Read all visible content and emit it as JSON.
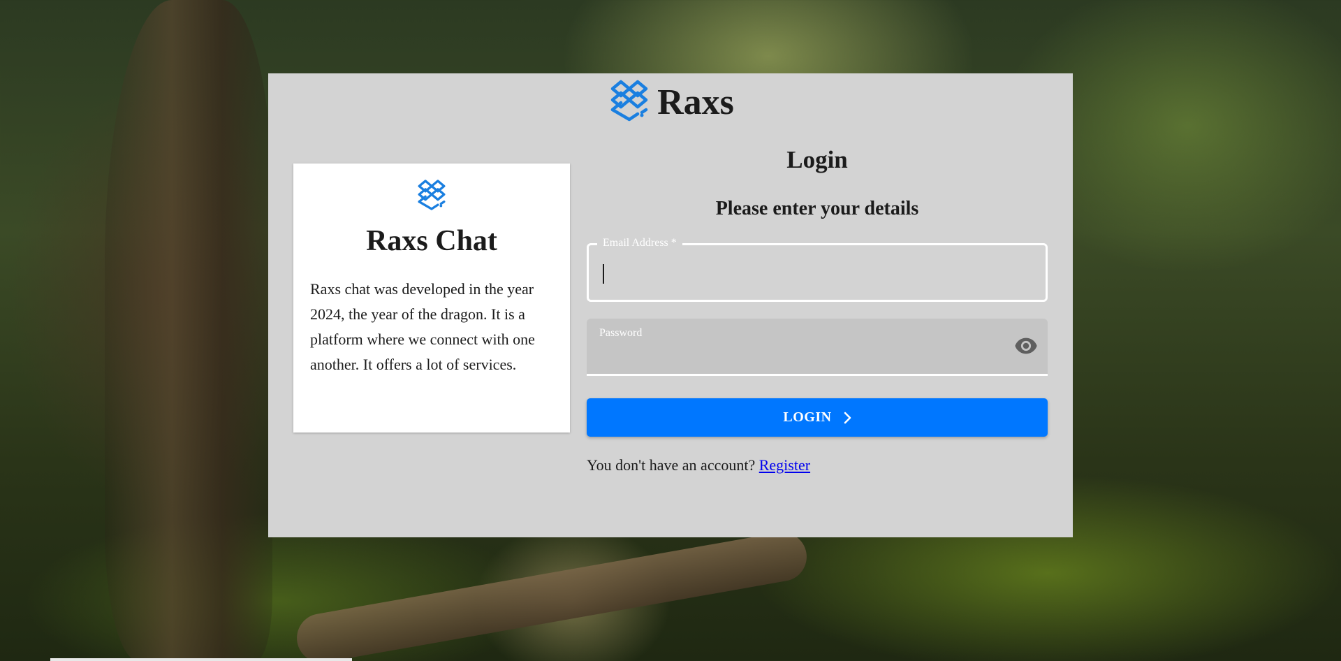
{
  "brand": {
    "name": "Raxs",
    "logo_icon": "stacked-diamond-logo-icon",
    "accent_color": "#1a7fe0"
  },
  "info_card": {
    "title": "Raxs Chat",
    "description": "Raxs chat was developed in the year 2024, the year of the dragon. It is a platform where we connect with one another. It offers a lot of services."
  },
  "form": {
    "heading": "Login",
    "subheading": "Please enter your details",
    "email": {
      "label": "Email Address *",
      "value": ""
    },
    "password": {
      "label": "Password",
      "value": "",
      "toggle_icon": "eye-icon"
    },
    "login_button": {
      "label": "LOGIN",
      "icon": "chevron-right-icon",
      "color": "#0077ff"
    },
    "register": {
      "prompt": "You don't have an account? ",
      "link_label": "Register"
    }
  }
}
